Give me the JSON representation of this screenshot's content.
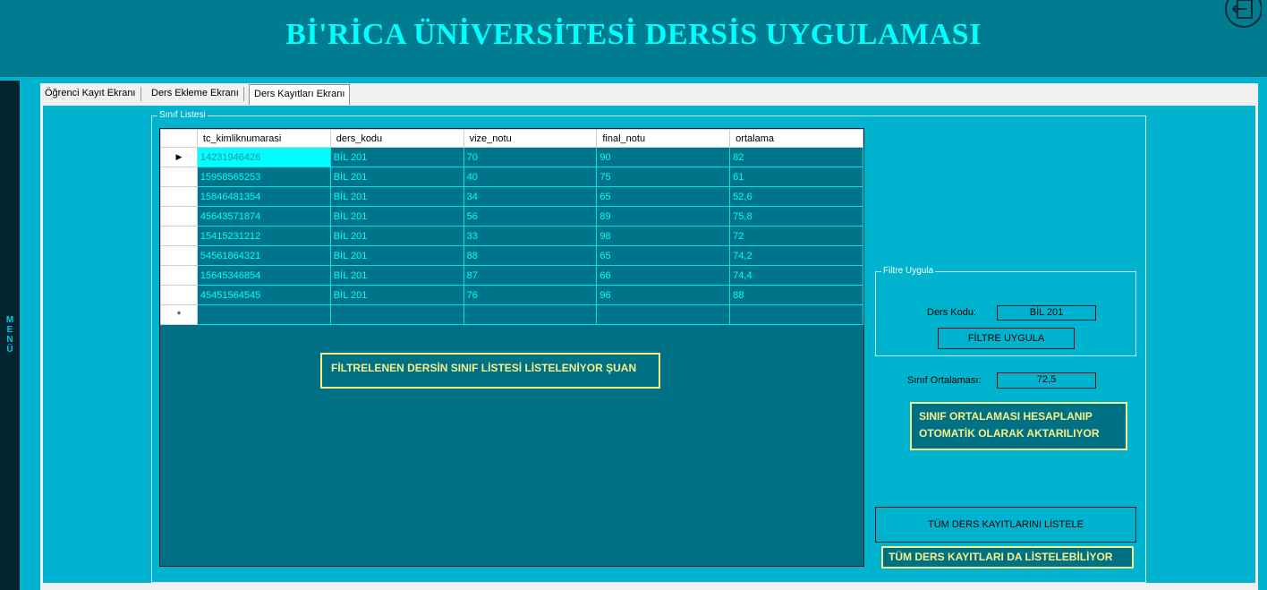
{
  "app": {
    "title": "Bİ'RİCA ÜNİVERSİTESİ DERSİS UYGULAMASI",
    "menu_letters": [
      "M",
      "E",
      "N",
      "Ü"
    ]
  },
  "tabs": [
    {
      "label": "Öğrenci Kayıt Ekranı",
      "active": false
    },
    {
      "label": "Ders Ekleme Ekranı",
      "active": false
    },
    {
      "label": "Ders Kayıtları Ekranı",
      "active": true
    }
  ],
  "class_list": {
    "group_label": "Sınıf Listesi",
    "columns": [
      "tc_kimliknumarasi",
      "ders_kodu",
      "vize_notu",
      "final_notu",
      "ortalama"
    ],
    "rows": [
      [
        "14231946426",
        "BİL 201",
        "70",
        "90",
        "82"
      ],
      [
        "15958565253",
        "BİL 201",
        "40",
        "75",
        "61"
      ],
      [
        "15846481354",
        "BİL 201",
        "34",
        "65",
        "52,6"
      ],
      [
        "45643571874",
        "BİL 201",
        "56",
        "89",
        "75,8"
      ],
      [
        "15415231212",
        "BİL 201",
        "33",
        "98",
        "72"
      ],
      [
        "54561864321",
        "BİL 201",
        "88",
        "65",
        "74,2"
      ],
      [
        "15645346854",
        "BİL 201",
        "87",
        "66",
        "74,4"
      ],
      [
        "45451564545",
        "BİL 201",
        "76",
        "96",
        "88"
      ]
    ],
    "current_row_marker": "▶",
    "new_row_marker": "*"
  },
  "filter": {
    "group_label": "Filtre Uygula",
    "ders_kodu_label": "Ders Kodu:",
    "ders_kodu_value": "BİL 201",
    "apply_button": "FİLTRE UYGULA"
  },
  "average": {
    "label": "Sınıf Ortalaması:",
    "value": "72,5"
  },
  "list_all_button": "TÜM DERS KAYITLARINI LİSTELE",
  "annotations": {
    "grid_note": "FİLTRELENEN DERSİN SINIF LİSTESİ LİSTELENİYOR ŞUAN",
    "average_note_line1": "SINIF ORTALAMASI HESAPLANIP",
    "average_note_line2": "OTOMATİK OLARAK AKTARILIYOR",
    "list_all_note": "TÜM DERS KAYITLARI DA LİSTELEBİLİYOR"
  },
  "colors": {
    "header_bg": "#007c91",
    "panel_bg": "#00b4cf",
    "grid_bg": "#007084",
    "cell_text": "#00ffff",
    "annotation": "#f7f088"
  }
}
